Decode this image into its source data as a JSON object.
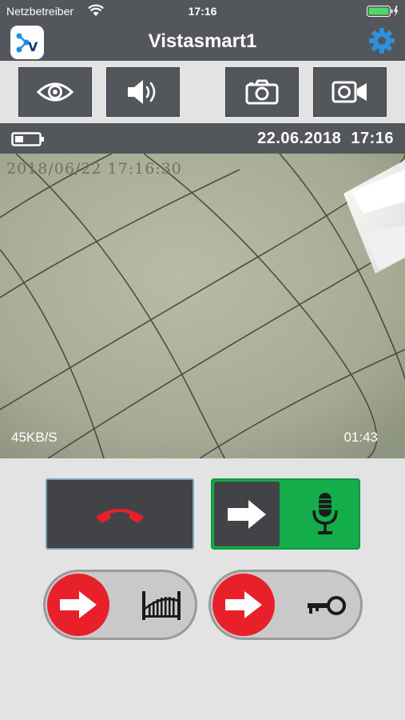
{
  "status": {
    "carrier": "Netzbetreiber",
    "time": "17:16"
  },
  "app": {
    "title": "Vistasmart1",
    "logo_letter": "V"
  },
  "toolbar": {
    "buttons": [
      "eye-icon",
      "speaker-icon",
      "camera-icon",
      "video-camera-icon"
    ]
  },
  "info": {
    "date": "22.06.2018",
    "time": "17:16"
  },
  "video": {
    "osd_timestamp": "2018/06/22 17:16:30",
    "bitrate": "45KB/S",
    "elapsed": "01:43"
  },
  "controls": {
    "hangup_icon": "phone-hangup-icon",
    "talk_icons": [
      "arrow-right-icon",
      "microphone-icon"
    ],
    "gate_icons": [
      "arrow-right-icon",
      "gate-icon"
    ],
    "door_icons": [
      "arrow-right-icon",
      "key-icon"
    ]
  },
  "colors": {
    "bar": "#53575c",
    "accent": "#2f8fd8",
    "green": "#13ad4c",
    "red": "#e8202a",
    "dark": "#414346"
  }
}
